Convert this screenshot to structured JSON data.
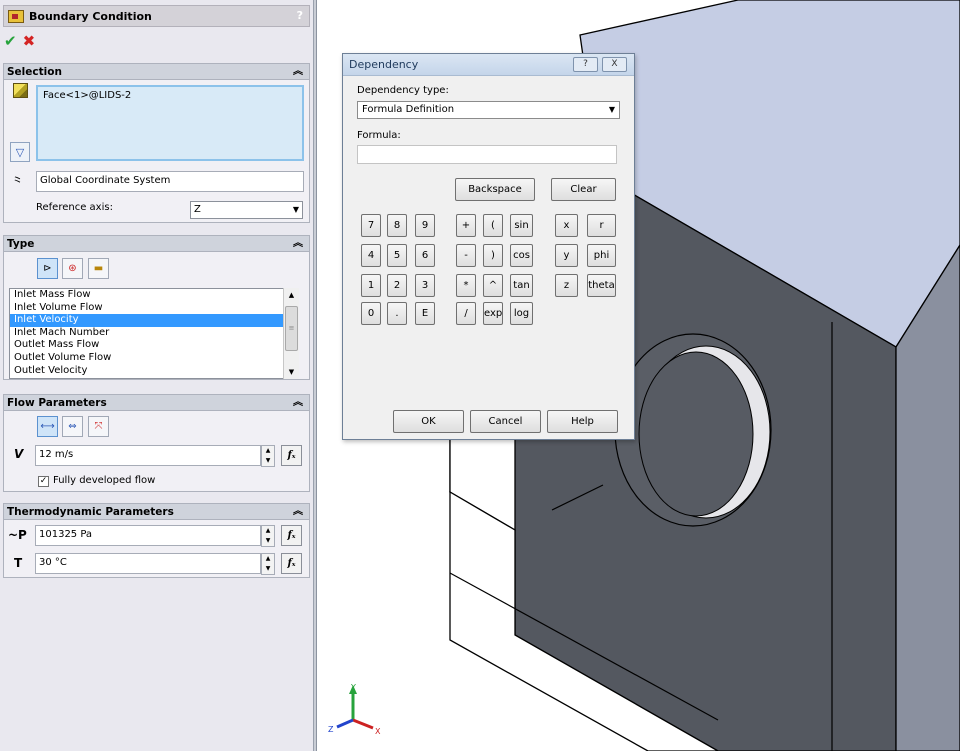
{
  "panel": {
    "title": "Boundary Condition",
    "help": "?",
    "selection": {
      "header": "Selection",
      "item": "Face<1>@LIDS-2",
      "coordinate_system": "Global Coordinate System",
      "reference_axis_label": "Reference axis:",
      "reference_axis_value": "Z"
    },
    "type": {
      "header": "Type",
      "items": [
        "Inlet Mass Flow",
        "Inlet Volume Flow",
        "Inlet Velocity",
        "Inlet Mach Number",
        "Outlet Mass Flow",
        "Outlet Volume Flow",
        "Outlet Velocity"
      ],
      "selected_index": 2
    },
    "flow": {
      "header": "Flow Parameters",
      "symbol": "V",
      "velocity": "12 m/s",
      "fully_developed_label": "Fully developed flow",
      "fully_developed_checked": true
    },
    "thermo": {
      "header": "Thermodynamic Parameters",
      "p_symbol": "~P",
      "pressure": "101325 Pa",
      "t_symbol": "T",
      "temperature": "30 °C"
    }
  },
  "dialog": {
    "title": "Dependency",
    "help_btn": "?",
    "close_btn": "X",
    "dep_type_label": "Dependency type:",
    "dep_type_value": "Formula Definition",
    "formula_label": "Formula:",
    "formula_value": "",
    "backspace": "Backspace",
    "clear": "Clear",
    "ok": "OK",
    "cancel": "Cancel",
    "help": "Help",
    "keys": {
      "k7": "7",
      "k8": "8",
      "k9": "9",
      "k4": "4",
      "k5": "5",
      "k6": "6",
      "k1": "1",
      "k2": "2",
      "k3": "3",
      "k0": "0",
      "kdot": ".",
      "kE": "E",
      "plus": "+",
      "lparen": "(",
      "sin": "sin",
      "minus": "-",
      "rparen": ")",
      "cos": "cos",
      "mul": "*",
      "pow": "^",
      "tan": "tan",
      "div": "/",
      "exp": "exp",
      "log": "log",
      "x": "x",
      "r": "r",
      "y": "y",
      "phi": "phi",
      "z": "z",
      "theta": "theta"
    }
  },
  "triad": {
    "x": "X",
    "y": "Y",
    "z": "Z"
  },
  "colors": {
    "selection": "#3399ff",
    "box_top": "#c5cde4",
    "box_front": "#545860",
    "box_right": "#8a909f"
  }
}
